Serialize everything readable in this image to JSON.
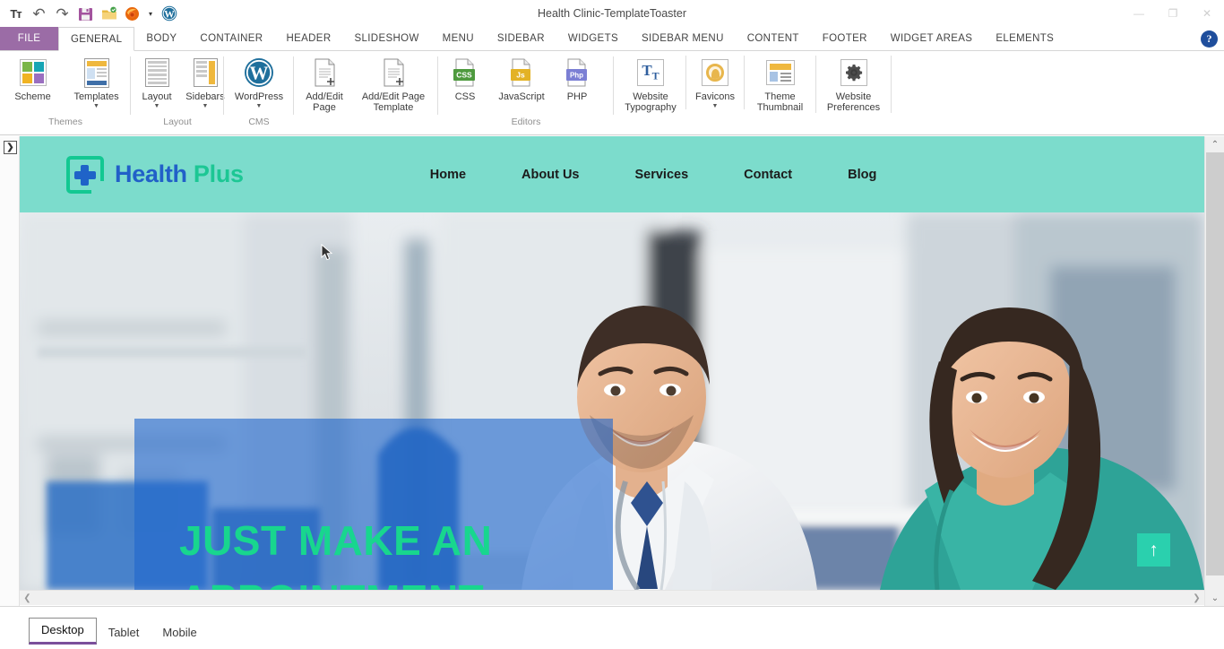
{
  "window": {
    "title": "Health Clinic-TemplateToaster",
    "minimize_label": "—",
    "restore_label": "❐",
    "close_label": "✕"
  },
  "quick_access": {
    "items": [
      {
        "name": "text-format-icon",
        "label": "Tᴛ"
      },
      {
        "name": "undo-icon",
        "label": "↶"
      },
      {
        "name": "redo-icon",
        "label": "↷"
      },
      {
        "name": "save-icon",
        "label": "save"
      },
      {
        "name": "open-folder-icon",
        "label": "open"
      },
      {
        "name": "firefox-preview-icon",
        "label": "firefox"
      },
      {
        "name": "preview-dropdown-icon",
        "label": "▾"
      },
      {
        "name": "wordpress-icon",
        "label": "wordpress"
      }
    ]
  },
  "ribbon_tabs": {
    "file": "FILE",
    "items": [
      {
        "label": "GENERAL",
        "active": true
      },
      {
        "label": "BODY",
        "active": false
      },
      {
        "label": "CONTAINER",
        "active": false
      },
      {
        "label": "HEADER",
        "active": false
      },
      {
        "label": "SLIDESHOW",
        "active": false
      },
      {
        "label": "MENU",
        "active": false
      },
      {
        "label": "SIDEBAR",
        "active": false
      },
      {
        "label": "WIDGETS",
        "active": false
      },
      {
        "label": "SIDEBAR MENU",
        "active": false
      },
      {
        "label": "CONTENT",
        "active": false
      },
      {
        "label": "FOOTER",
        "active": false
      },
      {
        "label": "WIDGET AREAS",
        "active": false
      },
      {
        "label": "ELEMENTS",
        "active": false
      }
    ],
    "help_label": "?"
  },
  "ribbon": {
    "groups": [
      {
        "name": "themes",
        "label": "Themes",
        "buttons": [
          {
            "name": "scheme-button",
            "caption": "Scheme",
            "has_caret": false
          },
          {
            "name": "templates-button",
            "caption": "Templates",
            "has_caret": true
          }
        ]
      },
      {
        "name": "layout",
        "label": "Layout",
        "buttons": [
          {
            "name": "layout-button",
            "caption": "Layout",
            "has_caret": true
          },
          {
            "name": "sidebars-button",
            "caption": "Sidebars",
            "has_caret": true
          }
        ]
      },
      {
        "name": "cms",
        "label": "CMS",
        "buttons": [
          {
            "name": "wordpress-button",
            "caption": "WordPress",
            "has_caret": true
          }
        ]
      },
      {
        "name": "pages",
        "label": "",
        "buttons": [
          {
            "name": "add-edit-page-button",
            "caption": "Add/Edit Page",
            "has_caret": false
          },
          {
            "name": "add-edit-page-template-button",
            "caption": "Add/Edit Page Template",
            "has_caret": false
          }
        ]
      },
      {
        "name": "editors",
        "label": "Editors",
        "buttons": [
          {
            "name": "css-editor-button",
            "caption": "CSS",
            "badge": "CSS",
            "badge_color": "#4e9a3e"
          },
          {
            "name": "javascript-editor-button",
            "caption": "JavaScript",
            "badge": "Js",
            "badge_color": "#e3b225"
          },
          {
            "name": "php-editor-button",
            "caption": "PHP",
            "badge": "Php",
            "badge_color": "#7b7fd4"
          }
        ]
      },
      {
        "name": "website-settings",
        "label": "",
        "buttons": [
          {
            "name": "website-typography-button",
            "caption": "Website Typography",
            "has_caret": false
          },
          {
            "name": "favicons-button",
            "caption": "Favicons",
            "has_caret": true
          },
          {
            "name": "theme-thumbnail-button",
            "caption": "Theme Thumbnail",
            "has_caret": false
          },
          {
            "name": "website-preferences-button",
            "caption": "Website Preferences",
            "has_caret": false
          }
        ]
      }
    ]
  },
  "preview": {
    "expand_panel_label": "❯",
    "site": {
      "brand": {
        "primary": "Health",
        "secondary": "Plus"
      },
      "nav": [
        {
          "label": "Home"
        },
        {
          "label": "About Us"
        },
        {
          "label": "Services"
        },
        {
          "label": "Contact"
        },
        {
          "label": "Blog"
        }
      ],
      "hero": {
        "title_line1": "JUST MAKE AN",
        "title_line2": "APPOINTMENT",
        "scroll_top_label": "↑"
      }
    },
    "scroll": {
      "left_arrow": "❮",
      "right_arrow": "❯",
      "up_arrow": "⌃",
      "down_arrow": "⌄"
    }
  },
  "bottom_bar": {
    "device_tabs": [
      {
        "label": "Desktop",
        "active": true
      },
      {
        "label": "Tablet",
        "active": false
      },
      {
        "label": "Mobile",
        "active": false
      }
    ]
  },
  "colors": {
    "file_tab_purple": "#9b6ca6",
    "site_header_teal": "#7cdccc",
    "brand_blue": "#2160c8",
    "brand_green": "#1cc794",
    "hero_overlay_blue": "#2068cd",
    "hero_title_green": "#18d68e",
    "accent_underline": "#7b4f9b"
  }
}
